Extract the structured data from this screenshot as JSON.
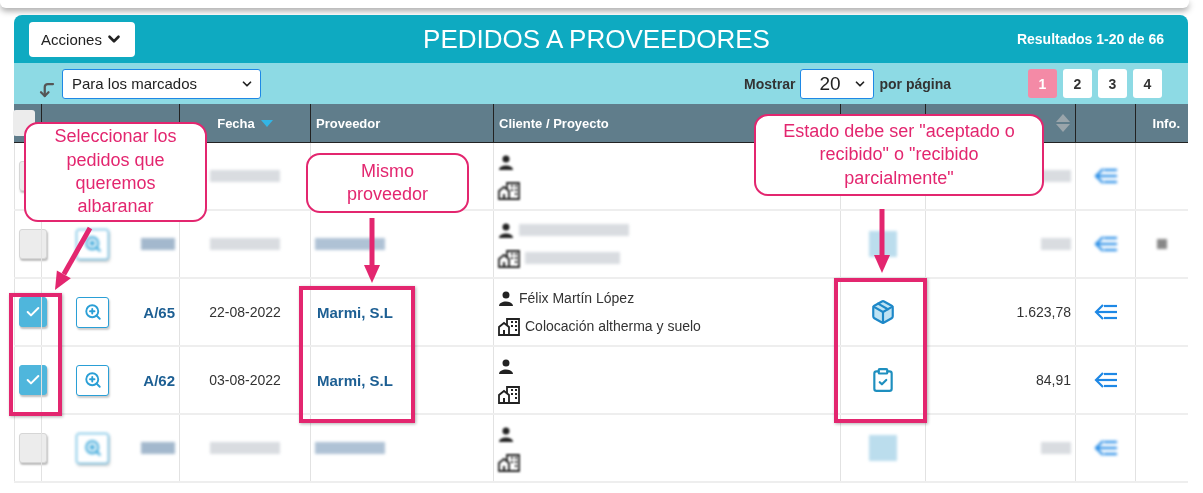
{
  "header": {
    "actions_button": "Acciones",
    "title": "PEDIDOS A PROVEEDORES",
    "results": "Resultados 1-20 de 66"
  },
  "bulk_bar": {
    "bulk_action": "Para los marcados",
    "show_label": "Mostrar",
    "per_page": "20",
    "per_page_suffix": "por página",
    "pages": [
      {
        "label": "1",
        "selected": true
      },
      {
        "label": "2",
        "selected": false
      },
      {
        "label": "3",
        "selected": false
      },
      {
        "label": "4",
        "selected": false
      }
    ]
  },
  "table": {
    "select_all": {
      "checked": false
    },
    "columns": {
      "fecha": "Fecha",
      "proveedor": "Proveedor",
      "cliente": "Cliente / Proyecto",
      "info": "Info."
    },
    "rows": [
      {
        "blurred": true,
        "checked": false,
        "has_info": false,
        "blurred_parts": [
          {
            "kind": "date"
          },
          {
            "kind": "amount"
          }
        ]
      },
      {
        "blurred": true,
        "checked": false,
        "has_info": true,
        "blurred_parts": [
          {
            "kind": "zoom"
          },
          {
            "kind": "number"
          },
          {
            "kind": "date"
          },
          {
            "kind": "supplier"
          },
          {
            "kind": "status"
          },
          {
            "kind": "amount"
          }
        ]
      },
      {
        "blurred": false,
        "checked": true,
        "has_info": false,
        "number": "A/65",
        "date": "22-08-2022",
        "supplier": "Marmi, S.L",
        "client": "Félix Martín López",
        "project": "Colocación altherma y suelo",
        "kind": "package",
        "amount": "1.623,78"
      },
      {
        "blurred": false,
        "checked": true,
        "has_info": false,
        "number": "A/62",
        "date": "03-08-2022",
        "supplier": "Marmi, S.L",
        "kind": "clipboard",
        "amount": "84,91"
      },
      {
        "blurred": true,
        "checked": false,
        "has_info": false,
        "blurred_parts": [
          {
            "kind": "zoom"
          },
          {
            "kind": "number"
          },
          {
            "kind": "date"
          },
          {
            "kind": "supplier"
          },
          {
            "kind": "status"
          },
          {
            "kind": "amount"
          }
        ]
      }
    ]
  },
  "annotations": [
    {
      "text": "Seleccionar los pedidos que queremos albaranar"
    },
    {
      "text": "Mismo proveedor"
    },
    {
      "text": "Estado debe ser \"aceptado o recibido\" o \"recibido parcialmente\""
    }
  ]
}
